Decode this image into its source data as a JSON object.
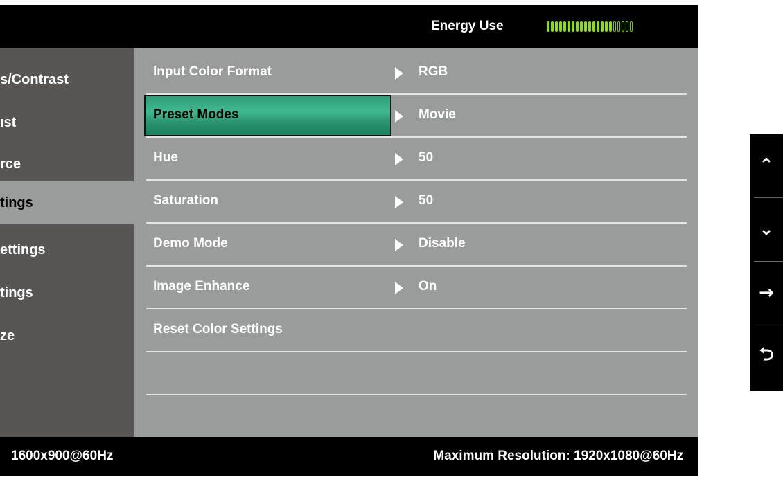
{
  "header": {
    "energy_label": "Energy Use",
    "energy_level_segments_on": 16,
    "energy_level_segments_total": 21,
    "energy_color": "#8ee000"
  },
  "sidebar": {
    "items": [
      {
        "label": "s/Contrast",
        "selected": false
      },
      {
        "label": "ıst",
        "selected": false
      },
      {
        "label": "rce",
        "selected": false
      },
      {
        "label": "tings",
        "selected": true
      },
      {
        "label": "ettings",
        "selected": false
      },
      {
        "label": "tings",
        "selected": false
      },
      {
        "label": "ze",
        "selected": false
      }
    ]
  },
  "menu": {
    "rows": [
      {
        "label": "Input Color Format",
        "value": "RGB",
        "has_arrow": true,
        "selected": false
      },
      {
        "label": "Preset Modes",
        "value": "Movie",
        "has_arrow": true,
        "selected": true
      },
      {
        "label": "Hue",
        "value": "50",
        "has_arrow": true,
        "selected": false
      },
      {
        "label": "Saturation",
        "value": "50",
        "has_arrow": true,
        "selected": false
      },
      {
        "label": "Demo Mode",
        "value": "Disable",
        "has_arrow": true,
        "selected": false
      },
      {
        "label": "Image Enhance",
        "value": "On",
        "has_arrow": true,
        "selected": false
      },
      {
        "label": "Reset Color Settings",
        "value": "",
        "has_arrow": false,
        "selected": false
      },
      {
        "label": "",
        "value": "",
        "has_arrow": false,
        "selected": false
      }
    ],
    "highlight_color": "#41b890"
  },
  "footer": {
    "current_resolution": "1600x900@60Hz",
    "max_resolution": "Maximum Resolution: 1920x1080@60Hz"
  },
  "nav": {
    "buttons": [
      {
        "name": "up-button",
        "icon": "chevron-up-icon",
        "glyph": "⌃"
      },
      {
        "name": "down-button",
        "icon": "chevron-down-icon",
        "glyph": "⌄"
      },
      {
        "name": "enter-button",
        "icon": "arrow-right-icon",
        "glyph": "→"
      },
      {
        "name": "back-button",
        "icon": "return-icon",
        "glyph": "⮌"
      }
    ]
  }
}
